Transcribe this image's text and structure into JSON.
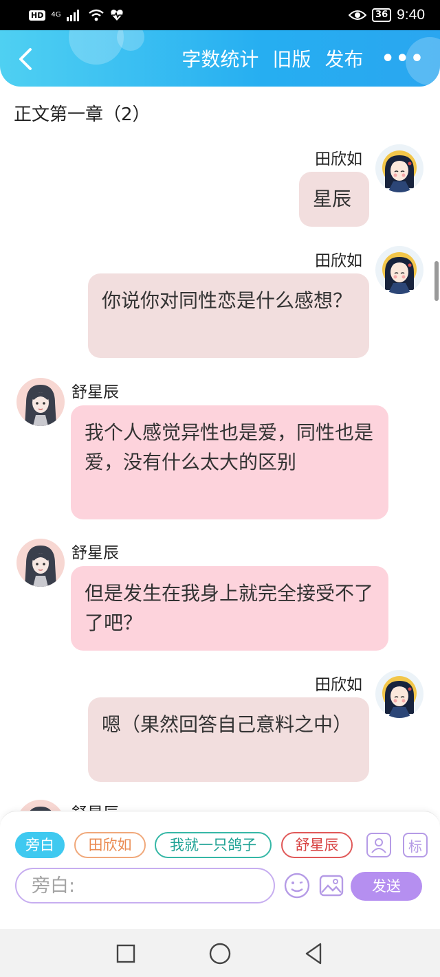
{
  "status_bar": {
    "hd": "HD",
    "network": "4G",
    "battery": "36",
    "time": "9:40"
  },
  "header": {
    "word_count": "字数统计",
    "old_version": "旧版",
    "publish": "发布",
    "more": "•••"
  },
  "chapter": {
    "title": "正文第一章（2）"
  },
  "messages": [
    {
      "side": "right",
      "speaker": "田欣如",
      "text": "星辰"
    },
    {
      "side": "right",
      "speaker": "田欣如",
      "text": "你说你对同性恋是什么感想？"
    },
    {
      "side": "left",
      "speaker": "舒星辰",
      "text": "我个人感觉异性也是爱，同性也是爱，没有什么太大的区别"
    },
    {
      "side": "left",
      "speaker": "舒星辰",
      "text": "但是发生在我身上就完全接受不了了吧？"
    },
    {
      "side": "right",
      "speaker": "田欣如",
      "text": "嗯（果然回答自己意料之中）"
    },
    {
      "side": "left",
      "speaker": "舒星辰",
      "text": ""
    }
  ],
  "composer": {
    "roles": [
      "旁白",
      "田欣如",
      "我就一只鸽子",
      "舒星辰"
    ],
    "tool_label": "标",
    "input_placeholder": "旁白:",
    "send_label": "发送"
  },
  "colors": {
    "header_blue": "#26aef1",
    "bubble_right": "#f2dede",
    "bubble_left": "#fdd3dc",
    "send_purple": "#b58ff0"
  },
  "icons": {
    "back": "chevron-left-icon",
    "person_tool": "person-icon",
    "emoji": "smile-icon",
    "image": "image-icon",
    "nav_recents": "square-icon",
    "nav_home": "circle-icon",
    "nav_back": "triangle-back-icon"
  }
}
